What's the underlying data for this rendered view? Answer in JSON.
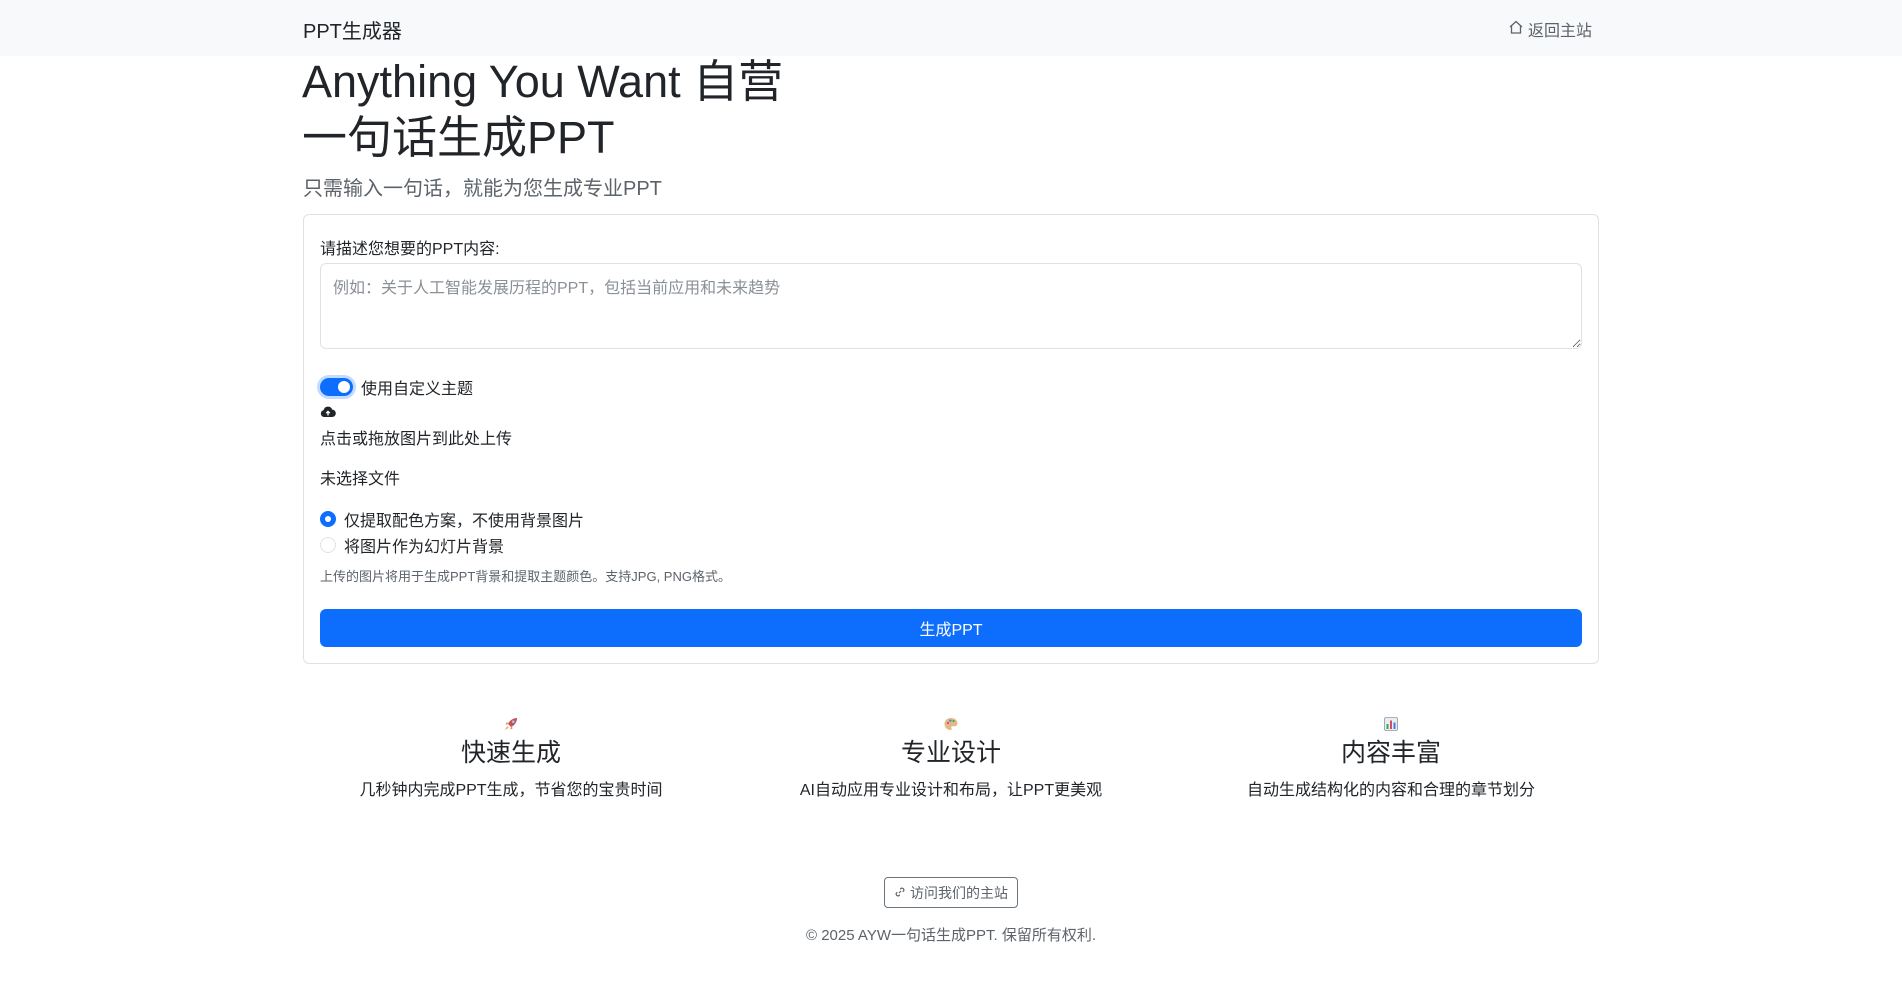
{
  "nav": {
    "brand": "PPT生成器",
    "home_link": "返回主站"
  },
  "hero": {
    "title": "Anything You Want 自营",
    "subtitle": "一句话生成PPT",
    "lead": "只需输入一句话，就能为您生成专业PPT"
  },
  "form": {
    "prompt_label": "请描述您想要的PPT内容:",
    "prompt_placeholder": "例如：关于人工智能发展历程的PPT，包括当前应用和未来趋势",
    "prompt_value": "",
    "custom_theme_label": "使用自定义主题",
    "custom_theme_enabled": true,
    "upload_text": "点击或拖放图片到此处上传",
    "file_status": "未选择文件",
    "radio_options": [
      {
        "label": "仅提取配色方案，不使用背景图片",
        "checked": true
      },
      {
        "label": "将图片作为幻灯片背景",
        "checked": false
      }
    ],
    "help_text": "上传的图片将用于生成PPT背景和提取主题颜色。支持JPG, PNG格式。",
    "submit_label": "生成PPT"
  },
  "features": [
    {
      "icon": "rocket-icon",
      "title": "快速生成",
      "desc": "几秒钟内完成PPT生成，节省您的宝贵时间"
    },
    {
      "icon": "palette-icon",
      "title": "专业设计",
      "desc": "AI自动应用专业设计和布局，让PPT更美观"
    },
    {
      "icon": "bar-chart-icon",
      "title": "内容丰富",
      "desc": "自动生成结构化的内容和合理的章节划分"
    }
  ],
  "footer": {
    "visit_button": "访问我们的主站",
    "copyright": "© 2025 AYW一句话生成PPT. 保留所有权利."
  },
  "colors": {
    "primary": "#0d6efd",
    "navbar_bg": "#f8f9fa",
    "muted_text": "#5c636a"
  }
}
